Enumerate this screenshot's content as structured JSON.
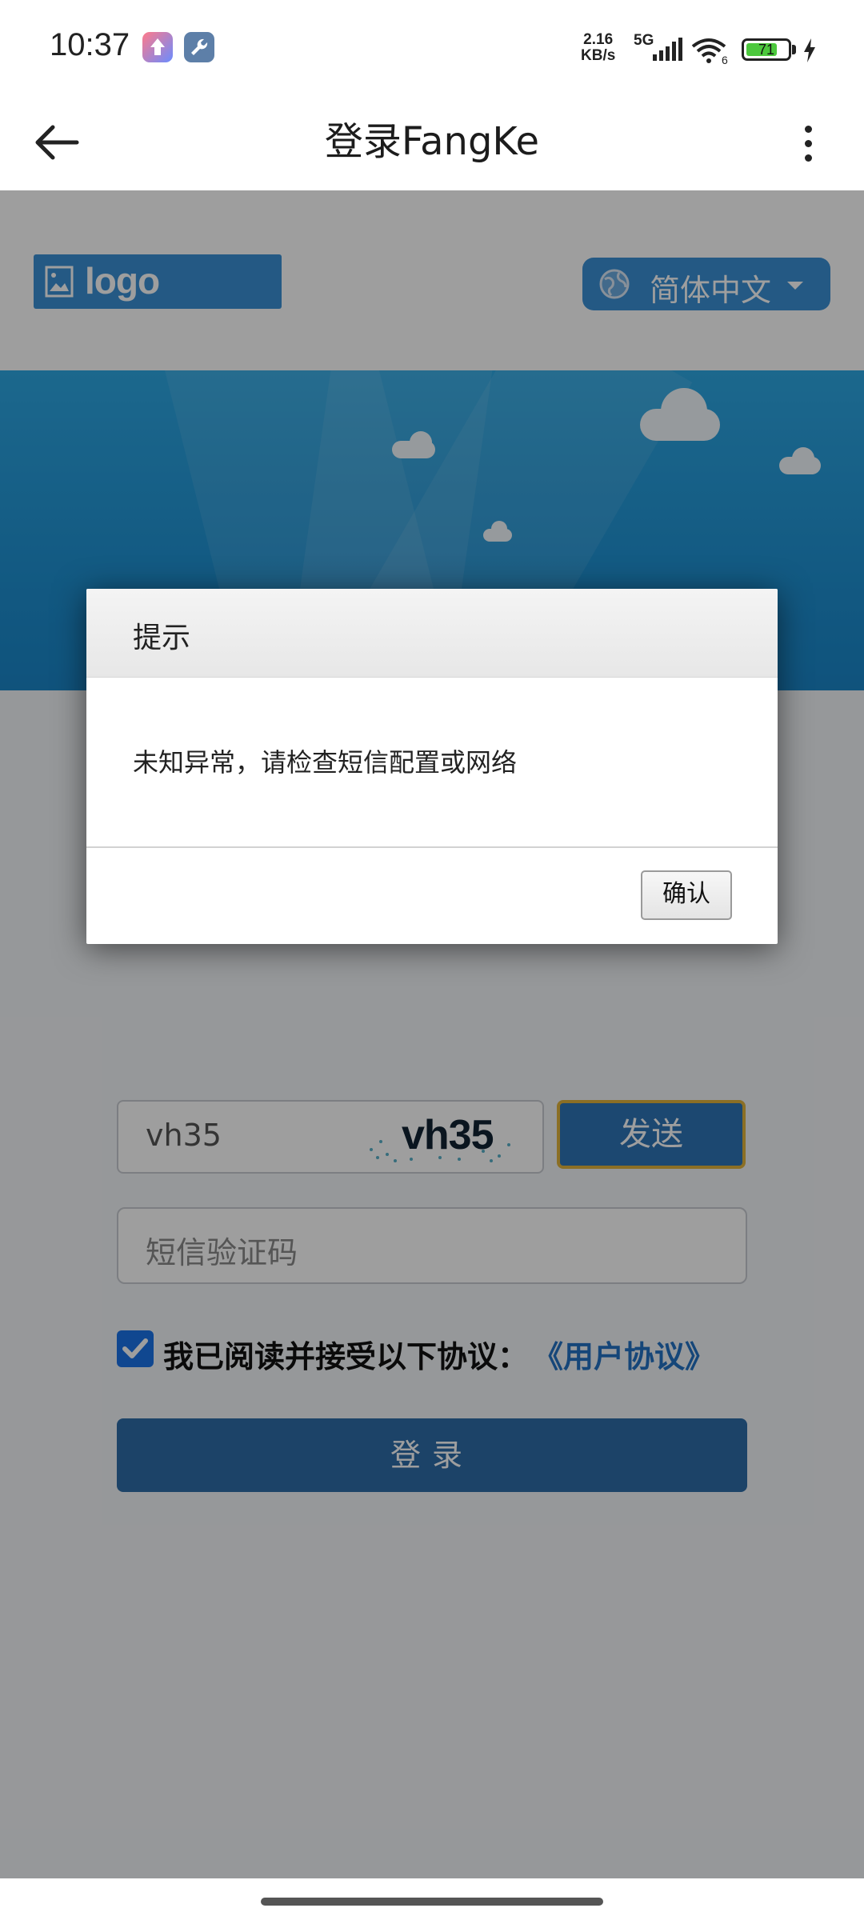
{
  "status_bar": {
    "time": "10:37",
    "net_speed_value": "2.16",
    "net_speed_unit": "KB/s",
    "signal_label": "5G",
    "battery": "71"
  },
  "titlebar": {
    "title": "登录FangKe",
    "back_icon": "arrow-left-icon",
    "more_icon": "more-vertical-icon"
  },
  "header": {
    "logo_text": "logo",
    "language": "简体中文"
  },
  "form": {
    "captcha_input_value": "vh35",
    "captcha_image_text": "vh35",
    "send_button": "发送",
    "sms_placeholder": "短信验证码",
    "agree_text": "我已阅读并接受以下协议：",
    "agreement_link": "《用户协议》",
    "login_button": "登录"
  },
  "dialog": {
    "title": "提示",
    "message": "未知异常，请检查短信配置或网络",
    "ok_button": "确认"
  },
  "colors": {
    "primary_blue": "#2e74b6",
    "link_blue": "#2272c3",
    "banner_blue": "#1d8fd1"
  }
}
